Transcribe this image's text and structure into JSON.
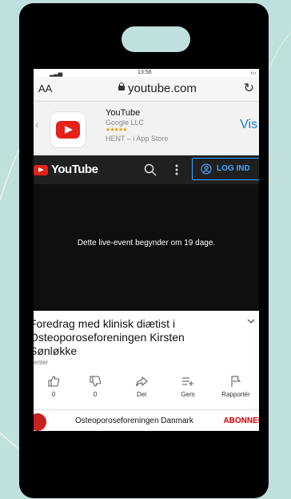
{
  "browser": {
    "status_time": "13:58",
    "text_size_label": "AA",
    "url": "youtube.com"
  },
  "app_banner": {
    "name": "YouTube",
    "developer": "Google LLC",
    "stars": "★★★★★",
    "store_text": "HENT – i App Store",
    "view_label": "Vis"
  },
  "yt_header": {
    "logo_text": "YouTube",
    "login_label": "LOG IND"
  },
  "player": {
    "message": "Dette live-event begynder om 19 dage."
  },
  "video": {
    "title": "Foredrag med klinisk diætist i Osteoporoseforeningen Kirsten Sønløkke",
    "subtitle": "venter"
  },
  "actions": [
    {
      "name": "like",
      "label": "0"
    },
    {
      "name": "dislike",
      "label": "0"
    },
    {
      "name": "share",
      "label": "Del"
    },
    {
      "name": "save",
      "label": "Gem"
    },
    {
      "name": "report",
      "label": "Rapportér"
    }
  ],
  "channel": {
    "name": "Osteoporoseforeningen Danmark",
    "subscribe_label": "ABONNER"
  },
  "colors": {
    "background": "#bfe0dd",
    "youtube_red": "#e62117",
    "link_blue": "#3ea6ff",
    "subscribe_red": "#cc0000"
  }
}
